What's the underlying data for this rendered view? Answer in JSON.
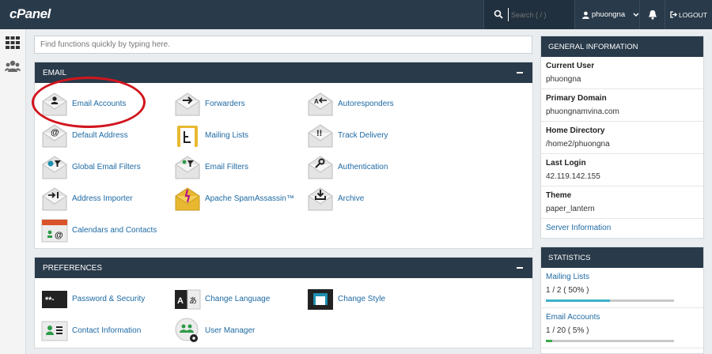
{
  "header": {
    "logo": "cPanel",
    "search_placeholder": "Search ( / )",
    "username": "phuongna",
    "logout_label": "LOGOUT"
  },
  "function_search": {
    "placeholder": "Find functions quickly by typing here."
  },
  "email": {
    "title": "EMAIL",
    "items": [
      {
        "label": "Email Accounts",
        "icon": "envelope-person-icon"
      },
      {
        "label": "Forwarders",
        "icon": "envelope-arrow-icon"
      },
      {
        "label": "Autoresponders",
        "icon": "envelope-autoreply-icon"
      },
      {
        "label": "Default Address",
        "icon": "envelope-at-icon"
      },
      {
        "label": "Mailing Lists",
        "icon": "mailing-list-icon"
      },
      {
        "label": "Track Delivery",
        "icon": "envelope-alert-icon"
      },
      {
        "label": "Global Email Filters",
        "icon": "envelope-globe-filter-icon"
      },
      {
        "label": "Email Filters",
        "icon": "envelope-filter-icon"
      },
      {
        "label": "Authentication",
        "icon": "envelope-key-icon"
      },
      {
        "label": "Address Importer",
        "icon": "envelope-import-icon"
      },
      {
        "label": "Apache SpamAssassin™",
        "icon": "spamassassin-icon"
      },
      {
        "label": "Archive",
        "icon": "envelope-archive-icon"
      },
      {
        "label": "Calendars and Contacts",
        "icon": "calendar-contacts-icon"
      }
    ]
  },
  "preferences": {
    "title": "PREFERENCES",
    "items": [
      {
        "label": "Password & Security",
        "icon": "password-icon"
      },
      {
        "label": "Change Language",
        "icon": "language-icon"
      },
      {
        "label": "Change Style",
        "icon": "style-icon"
      },
      {
        "label": "Contact Information",
        "icon": "contact-card-icon"
      },
      {
        "label": "User Manager",
        "icon": "user-manager-icon"
      }
    ]
  },
  "general_info": {
    "title": "GENERAL INFORMATION",
    "rows": [
      {
        "key": "Current User",
        "value": "phuongna"
      },
      {
        "key": "Primary Domain",
        "value": "phuongnamvina.com"
      },
      {
        "key": "Home Directory",
        "value": "/home2/phuongna"
      },
      {
        "key": "Last Login",
        "value": "42.119.142.155"
      },
      {
        "key": "Theme",
        "value": "paper_lantern"
      }
    ],
    "server_info_link": "Server Information"
  },
  "statistics": {
    "title": "STATISTICS",
    "rows": [
      {
        "label": "Mailing Lists",
        "value": "1 / 2 ( 50% )",
        "fraction": 0.5,
        "color": "#3cb0c9"
      },
      {
        "label": "Email Accounts",
        "value": "1 / 20 ( 5% )",
        "fraction": 0.05,
        "color": "#3aa84a"
      }
    ]
  },
  "colors": {
    "navy": "#293a4a",
    "link": "#1e6aa3",
    "annotation": "#d1151d"
  }
}
